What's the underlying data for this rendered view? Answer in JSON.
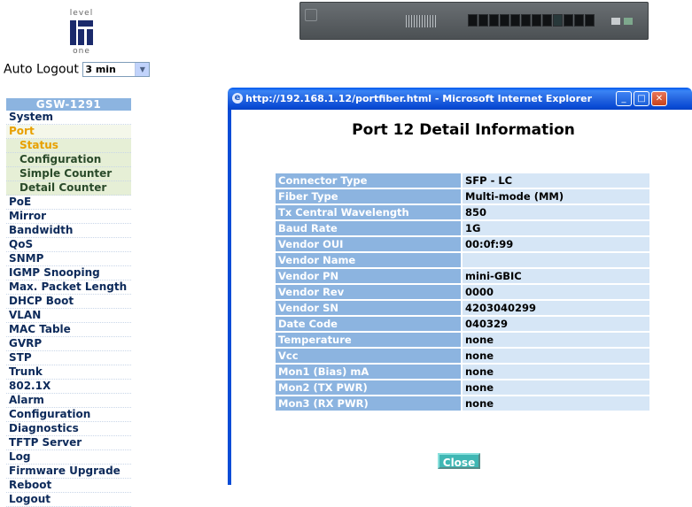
{
  "logo": {
    "top_text": "level",
    "bottom_text": "one"
  },
  "auto_logout": {
    "label": "Auto Logout",
    "value": "3 min"
  },
  "menu": {
    "header": "GSW-1291",
    "items": [
      {
        "label": "System",
        "type": "top"
      },
      {
        "label": "Port",
        "type": "port"
      },
      {
        "label": "Status",
        "type": "sub-active"
      },
      {
        "label": "Configuration",
        "type": "sub"
      },
      {
        "label": "Simple Counter",
        "type": "sub"
      },
      {
        "label": "Detail Counter",
        "type": "sub"
      },
      {
        "label": "PoE",
        "type": "top"
      },
      {
        "label": "Mirror",
        "type": "top"
      },
      {
        "label": "Bandwidth",
        "type": "top"
      },
      {
        "label": "QoS",
        "type": "top"
      },
      {
        "label": "SNMP",
        "type": "top"
      },
      {
        "label": "IGMP Snooping",
        "type": "top"
      },
      {
        "label": "Max. Packet Length",
        "type": "top"
      },
      {
        "label": "DHCP Boot",
        "type": "top"
      },
      {
        "label": "VLAN",
        "type": "top"
      },
      {
        "label": "MAC Table",
        "type": "top"
      },
      {
        "label": "GVRP",
        "type": "top"
      },
      {
        "label": "STP",
        "type": "top"
      },
      {
        "label": "Trunk",
        "type": "top"
      },
      {
        "label": "802.1X",
        "type": "top"
      },
      {
        "label": "Alarm",
        "type": "top"
      },
      {
        "label": "Configuration",
        "type": "top"
      },
      {
        "label": "Diagnostics",
        "type": "top"
      },
      {
        "label": "TFTP Server",
        "type": "top"
      },
      {
        "label": "Log",
        "type": "top"
      },
      {
        "label": "Firmware Upgrade",
        "type": "top"
      },
      {
        "label": "Reboot",
        "type": "top"
      },
      {
        "label": "Logout",
        "type": "top"
      }
    ]
  },
  "window": {
    "title": "http://192.168.1.12/portfiber.html - Microsoft Internet Explorer",
    "heading": "Port 12 Detail Information",
    "rows": [
      {
        "key": "Connector Type",
        "value": "SFP - LC"
      },
      {
        "key": "Fiber Type",
        "value": "Multi-mode (MM)"
      },
      {
        "key": "Tx Central Wavelength",
        "value": "850"
      },
      {
        "key": "Baud Rate",
        "value": "1G"
      },
      {
        "key": "Vendor OUI",
        "value": "00:0f:99"
      },
      {
        "key": "Vendor Name",
        "value": ""
      },
      {
        "key": "Vendor PN",
        "value": "mini-GBIC"
      },
      {
        "key": "Vendor Rev",
        "value": "0000"
      },
      {
        "key": "Vendor SN",
        "value": "4203040299"
      },
      {
        "key": "Date Code",
        "value": "040329"
      },
      {
        "key": "Temperature",
        "value": "none"
      },
      {
        "key": "Vcc",
        "value": "none"
      },
      {
        "key": "Mon1 (Bias) mA",
        "value": "none"
      },
      {
        "key": "Mon2 (TX PWR)",
        "value": "none"
      },
      {
        "key": "Mon3 (RX PWR)",
        "value": "none"
      }
    ],
    "close_label": "Close"
  },
  "colors": {
    "menu_header": "#8cb4e0",
    "active_item": "#e8a000",
    "close_button": "#3fb7b4"
  }
}
